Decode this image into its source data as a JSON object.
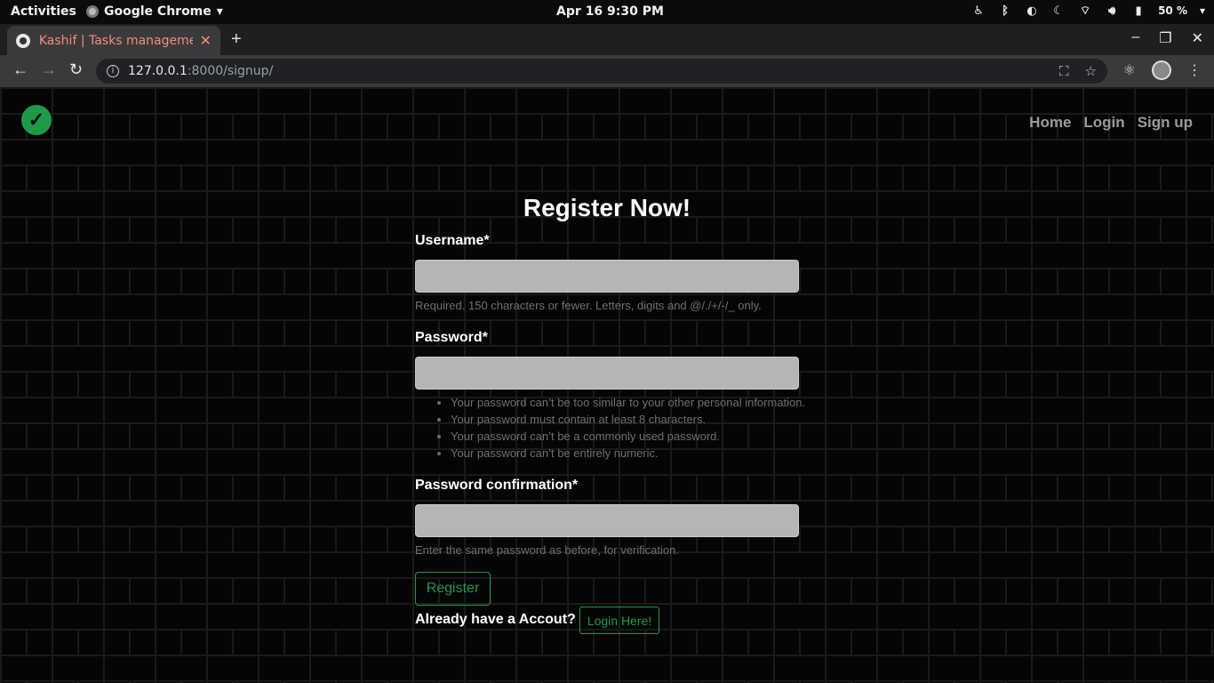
{
  "system_bar": {
    "activities": "Activities",
    "app_name": "Google Chrome",
    "clock": "Apr 16   9:30 PM",
    "battery": "50 %"
  },
  "browser": {
    "tab_title": "Kashif | Tasks management",
    "url_host": "127.0.0.1",
    "url_path": ":8000/signup/"
  },
  "site": {
    "nav": {
      "home": "Home",
      "login": "Login",
      "signup": "Sign up"
    }
  },
  "form": {
    "heading": "Register Now!",
    "username_label": "Username*",
    "username_value": "",
    "username_help": "Required. 150 characters or fewer. Letters, digits and @/./+/-/_ only.",
    "password_label": "Password*",
    "password_value": "",
    "password_rules": [
      "Your password can’t be too similar to your other personal information.",
      "Your password must contain at least 8 characters.",
      "Your password can’t be a commonly used password.",
      "Your password can’t be entirely numeric."
    ],
    "confirm_label": "Password confirmation*",
    "confirm_value": "",
    "confirm_help": "Enter the same password as before, for verification.",
    "register_button": "Register",
    "already_text": "Already have a Accout?",
    "login_here": "Login Here!"
  },
  "colors": {
    "accent": "#1e9a47",
    "input_bg": "#b5b5b5",
    "tab_text": "#f28b82"
  }
}
